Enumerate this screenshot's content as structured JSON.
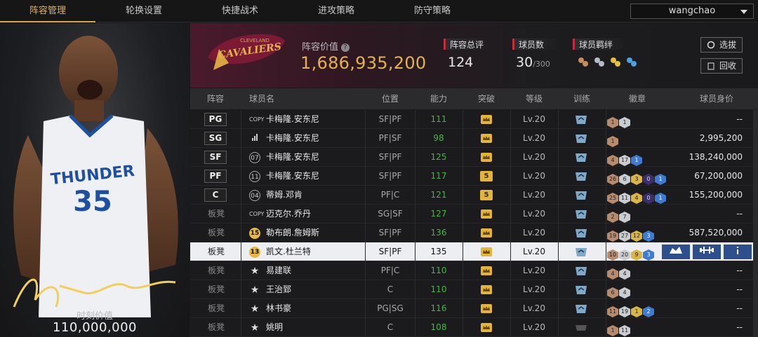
{
  "nav": {
    "tabs": [
      {
        "label": "阵容管理",
        "active": true
      },
      {
        "label": "轮换设置",
        "active": false
      },
      {
        "label": "快捷战术",
        "active": false
      },
      {
        "label": "进攻策略",
        "active": false
      },
      {
        "label": "防守策略",
        "active": false
      }
    ],
    "user": "wangchao"
  },
  "left_panel": {
    "moment_label": "时刻价值",
    "moment_value": "110,000,000",
    "jersey_team": "THUNDER",
    "jersey_number": "35"
  },
  "team": {
    "logo_small": "CLEVELAND",
    "logo_main": "CAVALIERS",
    "value_label": "阵容价值",
    "value": "1,686,935,200",
    "overall_label": "阵容总评",
    "overall": "124",
    "players_label": "球员数",
    "players": "30",
    "players_max": "/300",
    "chem_label": "球员羁绊",
    "select_btn": "选拔",
    "back_btn": "回收"
  },
  "table": {
    "headers": [
      "阵容",
      "球员名",
      "位置",
      "能力",
      "突破",
      "等级",
      "训练",
      "徽章",
      "球员身价"
    ],
    "rows": [
      {
        "slot": "PG",
        "tag": "COPY",
        "name": "卡梅隆.安东尼",
        "pos": "SF|PF",
        "ability": "111",
        "break": "crown",
        "level": "Lv.20",
        "badges": [
          [
            "br",
            "1"
          ],
          [
            "sv",
            "1"
          ]
        ],
        "salary": "--"
      },
      {
        "slot": "SG",
        "tag": "bars",
        "name": "卡梅隆.安东尼",
        "pos": "PF|SF",
        "ability": "98",
        "break": "crown",
        "level": "Lv.20",
        "badges": [
          [
            "br",
            "1"
          ]
        ],
        "salary": "2,995,200"
      },
      {
        "slot": "SF",
        "tag": "07",
        "name": "卡梅隆.安东尼",
        "pos": "SF|PF",
        "ability": "125",
        "break": "crown",
        "level": "Lv.20",
        "badges": [
          [
            "br",
            "4"
          ],
          [
            "sv",
            "17"
          ],
          [
            "bl",
            "1"
          ]
        ],
        "salary": "138,240,000"
      },
      {
        "slot": "PF",
        "tag": "11",
        "name": "卡梅隆.安东尼",
        "pos": "SF|PF",
        "ability": "117",
        "break": "5",
        "level": "Lv.20",
        "badges": [
          [
            "br",
            "26"
          ],
          [
            "sv",
            "6"
          ],
          [
            "gd",
            "3"
          ],
          [
            "pu",
            "0"
          ],
          [
            "bl",
            "1"
          ]
        ],
        "salary": "67,200,000"
      },
      {
        "slot": "C",
        "tag": "04",
        "name": "蒂姆.邓肯",
        "pos": "PF|C",
        "ability": "121",
        "break": "5",
        "level": "Lv.20",
        "badges": [
          [
            "br",
            "25"
          ],
          [
            "sv",
            "11"
          ],
          [
            "gd",
            "4"
          ],
          [
            "pu",
            "0"
          ],
          [
            "bl",
            "1"
          ]
        ],
        "salary": "155,200,000"
      },
      {
        "slot": "板凳",
        "tag": "COPY",
        "name": "迈克尔.乔丹",
        "pos": "SG|SF",
        "ability": "127",
        "break": "crown",
        "level": "Lv.20",
        "badges": [
          [
            "br",
            "2"
          ],
          [
            "sv",
            "7"
          ]
        ],
        "salary": "--"
      },
      {
        "slot": "板凳",
        "tag": "15",
        "name": "勒布朗.詹姆斯",
        "pos": "SF|PF",
        "ability": "136",
        "break": "crown",
        "level": "Lv.20",
        "badges": [
          [
            "br",
            "19"
          ],
          [
            "sv",
            "27"
          ],
          [
            "gd",
            "12"
          ],
          [
            "bl",
            "3"
          ]
        ],
        "salary": "587,520,000"
      },
      {
        "slot": "板凳",
        "tag": "13",
        "name": "凯文.杜兰特",
        "pos": "SF|PF",
        "ability": "135",
        "break": "crown",
        "level": "Lv.20",
        "badges": [
          [
            "br",
            "10"
          ],
          [
            "sv",
            "20"
          ],
          [
            "gd",
            "9"
          ],
          [
            "bl",
            "3"
          ]
        ],
        "salary": "",
        "selected": true
      },
      {
        "slot": "板凳",
        "tag": "star",
        "name": "易建联",
        "pos": "PF|C",
        "ability": "110",
        "break": "crown",
        "level": "Lv.20",
        "badges": [
          [
            "br",
            "4"
          ],
          [
            "sv",
            "4"
          ]
        ],
        "salary": "--"
      },
      {
        "slot": "板凳",
        "tag": "star",
        "name": "王治郅",
        "pos": "C",
        "ability": "110",
        "break": "crown",
        "level": "Lv.20",
        "badges": [
          [
            "br",
            "6"
          ],
          [
            "sv",
            "4"
          ]
        ],
        "salary": "--"
      },
      {
        "slot": "板凳",
        "tag": "star",
        "name": "林书豪",
        "pos": "PG|SG",
        "ability": "116",
        "break": "crown",
        "level": "Lv.20",
        "badges": [
          [
            "br",
            "11"
          ],
          [
            "sv",
            "19"
          ],
          [
            "gd",
            "1"
          ],
          [
            "bl",
            "2"
          ]
        ],
        "salary": "--"
      },
      {
        "slot": "板凳",
        "tag": "star",
        "name": "姚明",
        "pos": "C",
        "ability": "108",
        "break": "crown",
        "level": "Lv.20",
        "badges": [
          [
            "br",
            "1"
          ],
          [
            "sv",
            "11"
          ]
        ],
        "salary": "--"
      }
    ]
  },
  "colors": {
    "accent": "#e6b24a",
    "ability": "#47b548",
    "stat_bar": "#c0303a",
    "selected_btn": "#2d4f8c"
  }
}
